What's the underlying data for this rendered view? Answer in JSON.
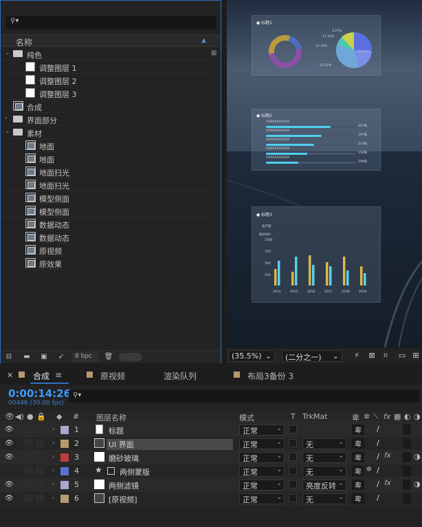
{
  "project": {
    "name_header": "名称",
    "items": [
      {
        "type": "folder",
        "label": "纯色",
        "indent": 0,
        "expanded": true
      },
      {
        "type": "solid",
        "label": "调整图层 1",
        "indent": 1
      },
      {
        "type": "solid",
        "label": "调整图层 2",
        "indent": 1
      },
      {
        "type": "solid",
        "label": "调整图层 3",
        "indent": 1
      },
      {
        "type": "comp",
        "label": "合成",
        "indent": 0
      },
      {
        "type": "folder",
        "label": "界面部分",
        "indent": 0,
        "expanded": false
      },
      {
        "type": "folder",
        "label": "素材",
        "indent": 0,
        "expanded": true
      },
      {
        "type": "comp",
        "label": "地面",
        "indent": 1
      },
      {
        "type": "comp",
        "label": "地面",
        "indent": 1
      },
      {
        "type": "comp",
        "label": "地面扫光",
        "indent": 1
      },
      {
        "type": "comp",
        "label": "地面扫光",
        "indent": 1
      },
      {
        "type": "comp",
        "label": "模型侧面",
        "indent": 1
      },
      {
        "type": "comp",
        "label": "模型侧面",
        "indent": 1
      },
      {
        "type": "comp",
        "label": "数据动态",
        "indent": 1
      },
      {
        "type": "comp",
        "label": "数据动态",
        "indent": 1
      },
      {
        "type": "comp",
        "label": "原视频",
        "indent": 1
      },
      {
        "type": "comp",
        "label": "原效果",
        "indent": 1
      }
    ],
    "bpc": "8 bpc"
  },
  "viewer": {
    "zoom": "(35.5%)",
    "resolution": "(二分之一)",
    "panel1": {
      "title": "标题1",
      "labels": [
        "2.27%",
        "11.16%",
        "12.74%",
        "53.82%",
        "15.02%"
      ]
    },
    "panel2": {
      "title": "标题2",
      "rows": [
        {
          "name": "XXXXXXXXXXX",
          "value": "407吨",
          "fill": 0.72
        },
        {
          "name": "XXXXXXXXXXX",
          "value": "397吨",
          "fill": 0.62
        },
        {
          "name": "XXXXXXXXXXX",
          "value": "313吨",
          "fill": 0.54
        },
        {
          "name": "XXXXXXXXXXX",
          "value": "256吨",
          "fill": 0.46
        },
        {
          "name": "XXXXXXXXXXX",
          "value": "209吨",
          "fill": 0.36
        }
      ]
    },
    "panel3": {
      "title": "标题3",
      "subtitle": "生产值",
      "unit": "吨/KWH",
      "ticks": [
        "1000",
        "750",
        "500",
        "250"
      ],
      "years": [
        "2014",
        "2015",
        "2016",
        "2017",
        "2018",
        "2019"
      ]
    }
  },
  "timeline": {
    "tabs": [
      {
        "label": "合成",
        "color": "#b69a6e",
        "active": true
      },
      {
        "label": "原视频",
        "color": "#b69a6e"
      },
      {
        "label": "渲染队列"
      },
      {
        "label": "布局3备份 3",
        "color": "#b69a6e"
      }
    ],
    "timecode": "0:00:14:26",
    "frames": "00446 (30.00 fps)",
    "headers": {
      "num": "#",
      "layer_name": "图层名称",
      "mode": "模式",
      "t": "T",
      "trkmat": "TrkMat"
    },
    "layers": [
      {
        "num": "1",
        "name": "标题",
        "color": "#a9a6d0",
        "icon": "text",
        "mode": "正常",
        "trk": "",
        "eye": true,
        "selected": false,
        "fx": false
      },
      {
        "num": "2",
        "name": "UI 界面",
        "color": "#b69a6e",
        "icon": "comp",
        "mode": "正常",
        "trk": "无",
        "eye": true,
        "selected": true,
        "fx": false
      },
      {
        "num": "3",
        "name": "磨砂玻璃",
        "color": "#c03a3a",
        "icon": "solid",
        "mode": "正常",
        "trk": "无",
        "eye": true,
        "selected": false,
        "fx": true
      },
      {
        "num": "4",
        "name": "两侧蒙版",
        "color": "#5a6fd0",
        "icon": "shape",
        "mode": "正常",
        "trk": "无",
        "eye": false,
        "selected": false,
        "fx": false
      },
      {
        "num": "5",
        "name": "两侧滤镜",
        "color": "#a9a6d0",
        "icon": "solid",
        "mode": "正常",
        "trk": "亮度反转",
        "eye": true,
        "selected": false,
        "fx": true
      },
      {
        "num": "6",
        "name": "[原视频]",
        "color": "#b69a6e",
        "icon": "comp",
        "mode": "正常",
        "trk": "无",
        "eye": true,
        "selected": false,
        "fx": false
      }
    ]
  },
  "colors": {
    "accent": "#2f6fc0",
    "timecode": "#3d9bff"
  }
}
